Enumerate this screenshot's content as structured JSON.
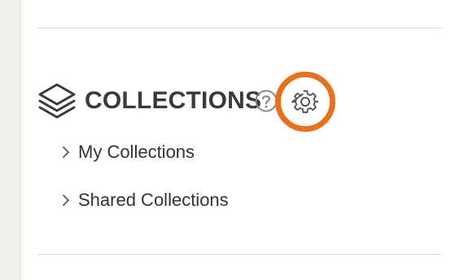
{
  "collections": {
    "title": "COLLECTIONS",
    "header_icon": "layers-icon",
    "help_icon": "question-circle-icon",
    "settings_icon": "gear-icon",
    "highlight_color": "#e8711f",
    "items": [
      {
        "label": "My Collections",
        "icon": "chevron-right-icon"
      },
      {
        "label": "Shared Collections",
        "icon": "chevron-right-icon"
      }
    ]
  }
}
